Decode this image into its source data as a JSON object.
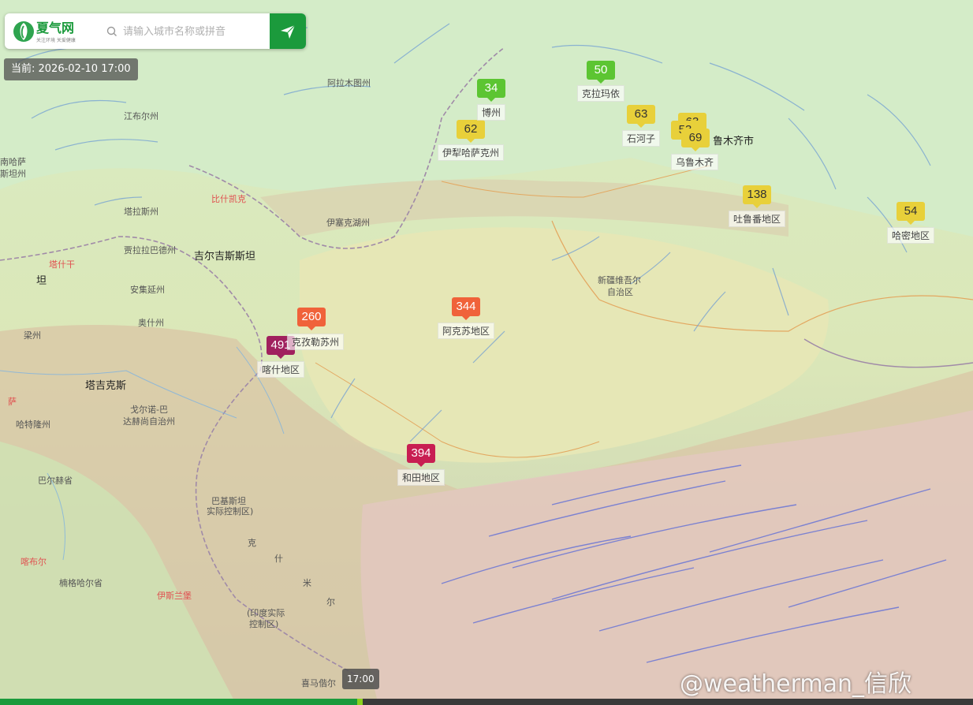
{
  "header": {
    "logo_text": "夏气网",
    "logo_slogan": "关注环境 关爱健康",
    "search_placeholder": "请输入城市名称或拼音",
    "search_icon": "search-icon",
    "send_icon": "paper-plane-icon",
    "accent_color": "#1b9a3c"
  },
  "current_time": "当前: 2026-02-10 17:00",
  "aqi_markers": [
    {
      "value": "34",
      "level": "good"
    },
    {
      "value": "50",
      "level": "good"
    },
    {
      "value": "62",
      "level": "moderate"
    },
    {
      "value": "63",
      "level": "moderate"
    },
    {
      "value": "63",
      "level": "moderate"
    },
    {
      "value": "53",
      "level": "moderate"
    },
    {
      "value": "69",
      "level": "moderate"
    },
    {
      "value": "138",
      "level": "moderate"
    },
    {
      "value": "54",
      "level": "moderate"
    },
    {
      "value": "344",
      "level": "unhealthy"
    },
    {
      "value": "260",
      "level": "unhealthy"
    },
    {
      "value": "491",
      "level": "hazard"
    },
    {
      "value": "394",
      "level": "very"
    }
  ],
  "city_labels": [
    "博州",
    "克拉玛依",
    "伊犁哈萨克州",
    "石河子",
    "乌鲁木齐",
    "吐鲁番地区",
    "哈密地区",
    "阿克苏地区",
    "克孜勒苏州",
    "喀什地区",
    "和田地区"
  ],
  "map_labels": {
    "urumqi_city": "鲁木齐市",
    "alamutu": "阿拉木图州",
    "jiangbuer": "江布尔州",
    "talas": "塔拉斯州",
    "jalalabad": "贾拉拉巴德州",
    "kyrgyz": "吉尔吉斯斯坦",
    "yixike": "伊塞克湖州",
    "bishkek": "比什凯克",
    "tashkent": "塔什干",
    "tan": "坦",
    "andijan": "安集延州",
    "osh": "奥什州",
    "xinjiang": "新疆维吾尔",
    "xinjiang2": "自治区",
    "gorno": "戈尔诺-巴",
    "gorno2": "达赫尚自治州",
    "khatlon": "哈特隆州",
    "tajik": "塔吉克斯",
    "balochistan": "巴基斯坦",
    "control": "实际控制区)",
    "india": "(印度实际",
    "control2": "控制区)",
    "himalaya": "喜马偕尔",
    "kunduz": "喀布尔",
    "bek": "楠格哈尔省",
    "islamabad": "伊斯兰堡",
    "kazakh_w": "南哈萨",
    "kazakh_w2": "斯坦州",
    "sheshe": "萨",
    "kashi_fragment": "梁州",
    "balkh": "巴尔赫省",
    "k": "克",
    "shi": "什",
    "mi": "米",
    "er": "尔"
  },
  "timeline": {
    "tooltip": "17:00",
    "progress_fraction": 0.367
  },
  "watermark": "@weatherman_信欣"
}
